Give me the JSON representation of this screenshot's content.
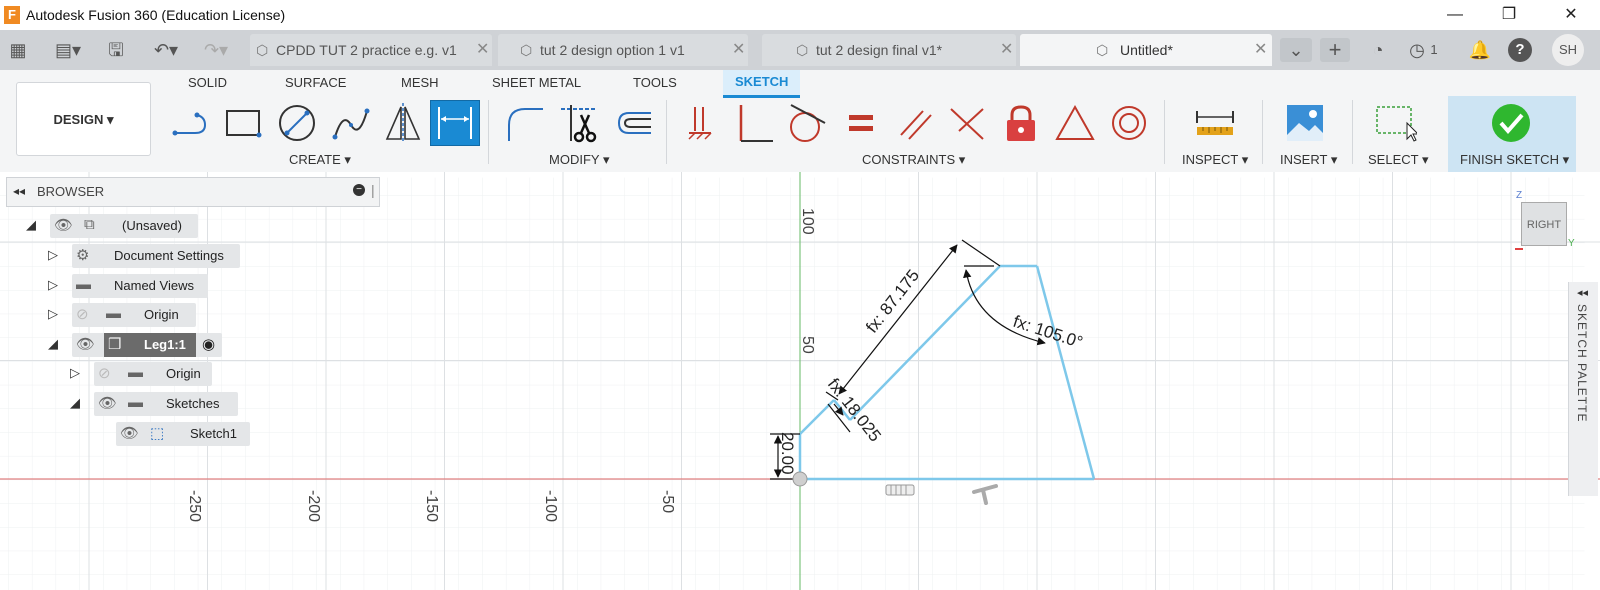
{
  "app": {
    "title": "Autodesk Fusion 360 (Education License)",
    "logo": "F"
  },
  "window_controls": {
    "minimize": "—",
    "maximize": "❐",
    "close": "✕"
  },
  "tabs": [
    {
      "label": "CPDD TUT 2 practice e.g. v1",
      "active": false
    },
    {
      "label": "tut 2 design option 1 v1",
      "active": false
    },
    {
      "label": "tut 2 design final v1*",
      "active": false
    },
    {
      "label": "Untitled*",
      "active": true
    }
  ],
  "tabbar_right": {
    "job_count": "1",
    "user_initials": "SH"
  },
  "workspace": {
    "label": "DESIGN"
  },
  "ribbon_tabs": [
    "SOLID",
    "SURFACE",
    "MESH",
    "SHEET METAL",
    "TOOLS",
    "SKETCH"
  ],
  "ribbon_groups": {
    "create": "CREATE",
    "modify": "MODIFY",
    "constraints": "CONSTRAINTS",
    "inspect": "INSPECT",
    "insert": "INSERT",
    "select": "SELECT",
    "finish": "FINISH SKETCH"
  },
  "browser": {
    "title": "BROWSER",
    "nodes": [
      {
        "label": "(Unsaved)"
      },
      {
        "label": "Document Settings"
      },
      {
        "label": "Named Views"
      },
      {
        "label": "Origin"
      },
      {
        "label": "Leg1:1"
      },
      {
        "label": "Origin"
      },
      {
        "label": "Sketches"
      },
      {
        "label": "Sketch1"
      }
    ]
  },
  "viewcube": {
    "face": "RIGHT",
    "axes": {
      "z": "Z",
      "y": "Y"
    }
  },
  "sketch_palette": {
    "label": "SKETCH PALETTE"
  },
  "ruler": {
    "vertical": [
      "100",
      "50"
    ],
    "horizontal": [
      "-250",
      "-200",
      "-150",
      "-100",
      "-50"
    ]
  },
  "dimensions": {
    "length": "fx: 87.175",
    "angle": "fx: 105.0°",
    "short": "fx: 18.025",
    "height": "20.00"
  },
  "colors": {
    "accent": "#1a8ad3",
    "sketch_line": "#7ec8ea",
    "x_axis": "#e08080",
    "y_axis": "#7ec47e",
    "grid": "#e5e7ea"
  }
}
